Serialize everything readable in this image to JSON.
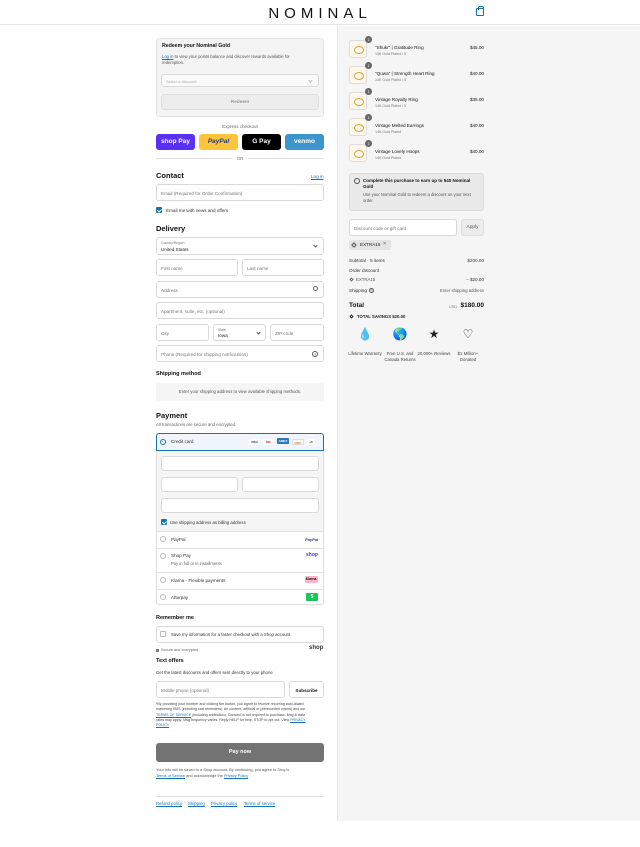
{
  "header": {
    "logo": "NOMINAL",
    "bag_icon": "shopping-bag-icon"
  },
  "redeem": {
    "title": "Redeem your Nominal Gold",
    "login_link": "Log in",
    "desc": "to view your points balance and discover rewards available for redemption.",
    "select_placeholder": "Select a discount",
    "button": "Redeem"
  },
  "express": {
    "label": "Express checkout",
    "buttons": [
      {
        "label": "shop Pay",
        "bg": "#5a31f4",
        "color": "#ffffff"
      },
      {
        "label": "PayPal",
        "bg": "#ffc439",
        "color": "#253b80"
      },
      {
        "label": "G Pay",
        "bg": "#000000",
        "color": "#ffffff"
      },
      {
        "label": "venmo",
        "bg": "#3d95ce",
        "color": "#ffffff"
      }
    ],
    "or": "OR"
  },
  "contact": {
    "title": "Contact",
    "login": "Log in",
    "email_placeholder": "Email (Required for Order Confirmation)",
    "news_label": "Email me with news and offers"
  },
  "delivery": {
    "title": "Delivery",
    "country_label": "Country/Region",
    "country_value": "United States",
    "first_name": "First name",
    "last_name": "Last name",
    "address": "Address",
    "apartment": "Apartment, suite, etc. (optional)",
    "city": "City",
    "state_label": "State",
    "state_value": "Iowa",
    "zip": "ZIP code",
    "phone": "Phone (Required for shipping notifications)"
  },
  "shipping": {
    "title": "Shipping method",
    "notice": "Enter your shipping address to view available shipping methods."
  },
  "payment": {
    "title": "Payment",
    "subtitle": "All transactions are secure and encrypted.",
    "credit_card": "Credit card",
    "card_logos": [
      "VISA",
      "MC",
      "AMEX",
      "DISC",
      "+6"
    ],
    "billing_label": "Use shipping address as billing address",
    "options": [
      {
        "label": "PayPal",
        "sub": "",
        "badge": "PayPal"
      },
      {
        "label": "Shop Pay",
        "sub": "Pay in full or in installments",
        "badge": "shop"
      },
      {
        "label": "Klarna - Flexible payments",
        "sub": "",
        "badge": "Klarna."
      },
      {
        "label": "Afterpay",
        "sub": "",
        "badge": "$"
      }
    ]
  },
  "remember": {
    "title": "Remember me",
    "save_label": "Save my information for a faster checkout with a Shop account",
    "secure": "Secure and encrypted",
    "shop": "shop"
  },
  "text_offers": {
    "title": "Text offers",
    "desc": "Get the latest discounts and offers sent directly to your phone",
    "phone_placeholder": "Mobile phone (optional)",
    "subscribe": "Subscribe",
    "legal1": "*By providing your number and clicking the button, you agree to receive recurring auto-dialed",
    "legal2": "marketing SMS (including cart reminders). An content, artificial or prerecorded voices) and our",
    "legal3_link": "TERMS OF SERVICE",
    "legal3": "(including arbitration). Consent is not required to purchase. Msg & data",
    "legal4": "rates may apply. Msg frequency varies. Reply HELP for help, STOP to opt out. View",
    "legal4_link": "PRIVACY",
    "legal5_link": "POLICY"
  },
  "pay_now": "Pay now",
  "shop_notice": {
    "line1": "Your info will be saved to a Shop account. By continuing, you agree to Shop's",
    "tos": "Terms of Service",
    "mid": "and acknowledge the",
    "privacy": "Privacy Policy"
  },
  "footer": [
    "Refund policy",
    "Shipping",
    "Privacy policy",
    "Terms of service"
  ],
  "cart": {
    "items": [
      {
        "qty": "1",
        "name": "\"Shukr\" | Gratitude Ring",
        "variant": "14K Gold Plated / 5",
        "price": "$45.00"
      },
      {
        "qty": "1",
        "name": "\"Quwa\" | Strength Heart Ring",
        "variant": "14K Gold Plated / 5",
        "price": "$40.00"
      },
      {
        "qty": "1",
        "name": "Vintage Royalty Ring",
        "variant": "14K Gold Plated / 5",
        "price": "$35.00"
      },
      {
        "qty": "1",
        "name": "Vintage Melted Earrings",
        "variant": "14K Gold Plated",
        "price": "$40.00"
      },
      {
        "qty": "1",
        "name": "Vintage Lovely Hoops",
        "variant": "14K Gold Plated",
        "price": "$40.00"
      }
    ],
    "earn_title": "Complete this purchase to earn up to 540 Nominal Gold",
    "earn_desc": "Use your Nominal Gold to redeem a discount on your next order.",
    "discount_placeholder": "Discount code or gift card",
    "apply": "Apply",
    "tag": "EXTRA15",
    "subtotal_label": "Subtotal · 5 items",
    "subtotal": "$200.00",
    "order_discount": "Order discount",
    "discount_code": "EXTRA15",
    "discount_value": "− $20.00",
    "shipping_label": "Shipping",
    "shipping_value": "Enter shipping address",
    "total_label": "Total",
    "currency": "USD",
    "total": "$180.00",
    "savings": "TOTAL SAVINGS $20.00",
    "trust": [
      {
        "icon": "drop-icon",
        "label": "Lifetime Warranty"
      },
      {
        "icon": "globe-arrows-icon",
        "label": "Free U.S. and Canada Returns"
      },
      {
        "icon": "stars-icon",
        "label": "20,000+ Reviews"
      },
      {
        "icon": "heart-icon",
        "label": "$1 Million+ Donated"
      }
    ]
  }
}
